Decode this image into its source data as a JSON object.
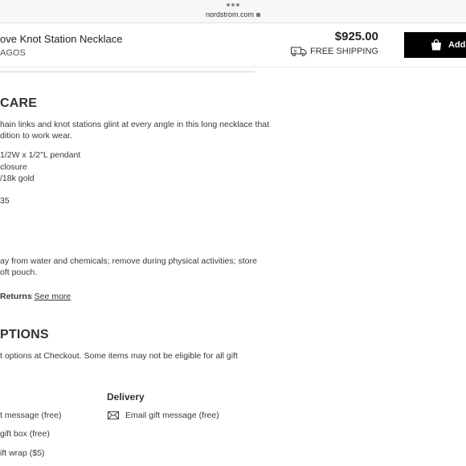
{
  "browser": {
    "url": "nordstrom.com"
  },
  "product": {
    "title": "ove Knot Station Necklace",
    "brand": "AGOS",
    "price": "$925.00",
    "shipping": "FREE SHIPPING",
    "add_button_label": "Add"
  },
  "details": {
    "heading": "CARE",
    "description": [
      "hain links and knot stations glint at every angle in this long necklace that",
      "dition to work wear."
    ],
    "specs": [
      "1/2W x 1/2\"L pendant",
      "closure",
      "/18k gold"
    ],
    "item_number": "35",
    "care": [
      "ay from water and chemicals; remove during physical activities; store",
      "oft pouch."
    ],
    "returns_label": "Returns",
    "see_more": "See more"
  },
  "gift_options": {
    "heading": "PTIONS",
    "description": "t options at Checkout. Some items may not be eligible for all gift",
    "delivery_heading": "Delivery",
    "left_options": [
      "t message (free)",
      "gift box (free)",
      "ift wrap ($5)"
    ],
    "email_option": "Email gift message (free)"
  }
}
